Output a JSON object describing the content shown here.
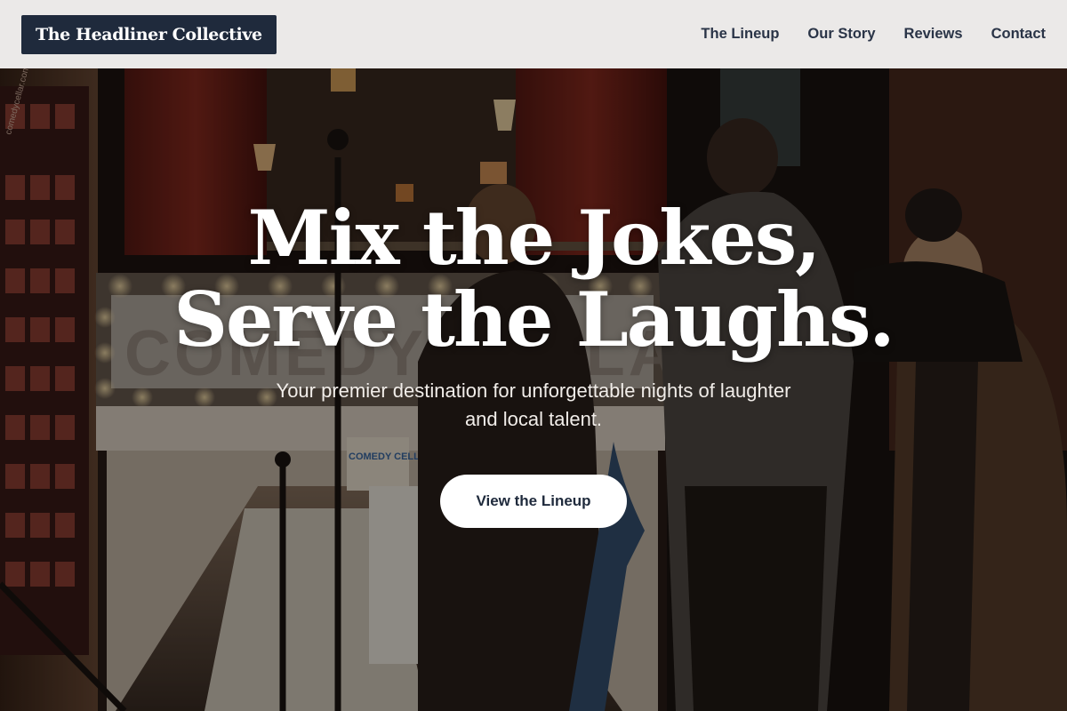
{
  "brand": {
    "name": "The Headliner Collective"
  },
  "nav": {
    "items": [
      {
        "label": "The Lineup"
      },
      {
        "label": "Our Story"
      },
      {
        "label": "Reviews"
      },
      {
        "label": "Contact"
      }
    ]
  },
  "hero": {
    "headline_line1": "Mix the Jokes,",
    "headline_line2": "Serve the Laughs.",
    "subtitle": "Your premier destination for unforgettable nights of laughter and local talent.",
    "cta_label": "View the Lineup",
    "background_marquee_text": "COMEDY CELLAR",
    "background_url_text": "comedycellar.com",
    "background_sign_text": "COMEDY CELLAR"
  },
  "colors": {
    "header_bg": "#ebe9e8",
    "logo_bg": "#1f2a3c",
    "nav_text": "#2a3447",
    "cta_bg": "#ffffff",
    "cta_text": "#1f2a3c",
    "headline_text": "#ffffff"
  }
}
